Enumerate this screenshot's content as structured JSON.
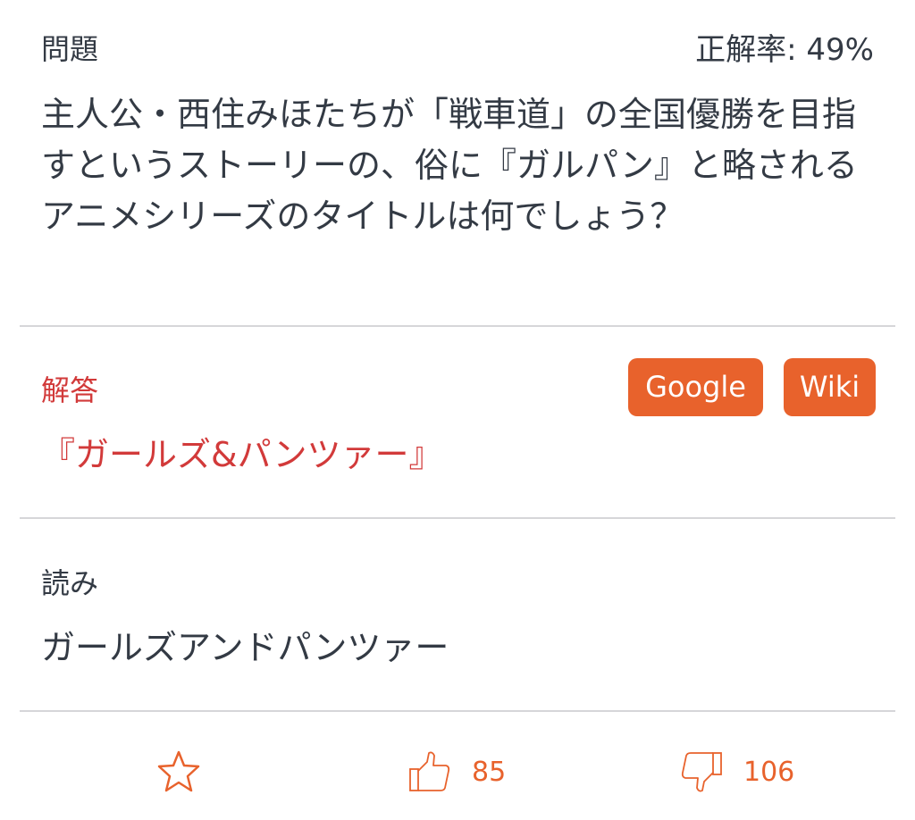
{
  "question": {
    "label": "問題",
    "rate": "正解率: 49%",
    "text": "主人公・西住みほたちが「戦車道」の全国優勝を目指すというストーリーの、俗に『ガルパン』と略されるアニメシリーズのタイトルは何でしょう？"
  },
  "answer": {
    "label": "解答",
    "text": "『ガールズ&パンツァー』",
    "buttons": {
      "google": "Google",
      "wiki": "Wiki"
    }
  },
  "reading": {
    "label": "読み",
    "text": "ガールズアンドパンツァー"
  },
  "footer": {
    "favorite_icon": "star-icon",
    "like_icon": "thumbs-up-icon",
    "like_count": "85",
    "dislike_icon": "thumbs-down-icon",
    "dislike_count": "106"
  },
  "colors": {
    "accent": "#e8622c",
    "answer": "#d23a3a",
    "text": "#333a44",
    "divider": "#d6d6d9"
  }
}
